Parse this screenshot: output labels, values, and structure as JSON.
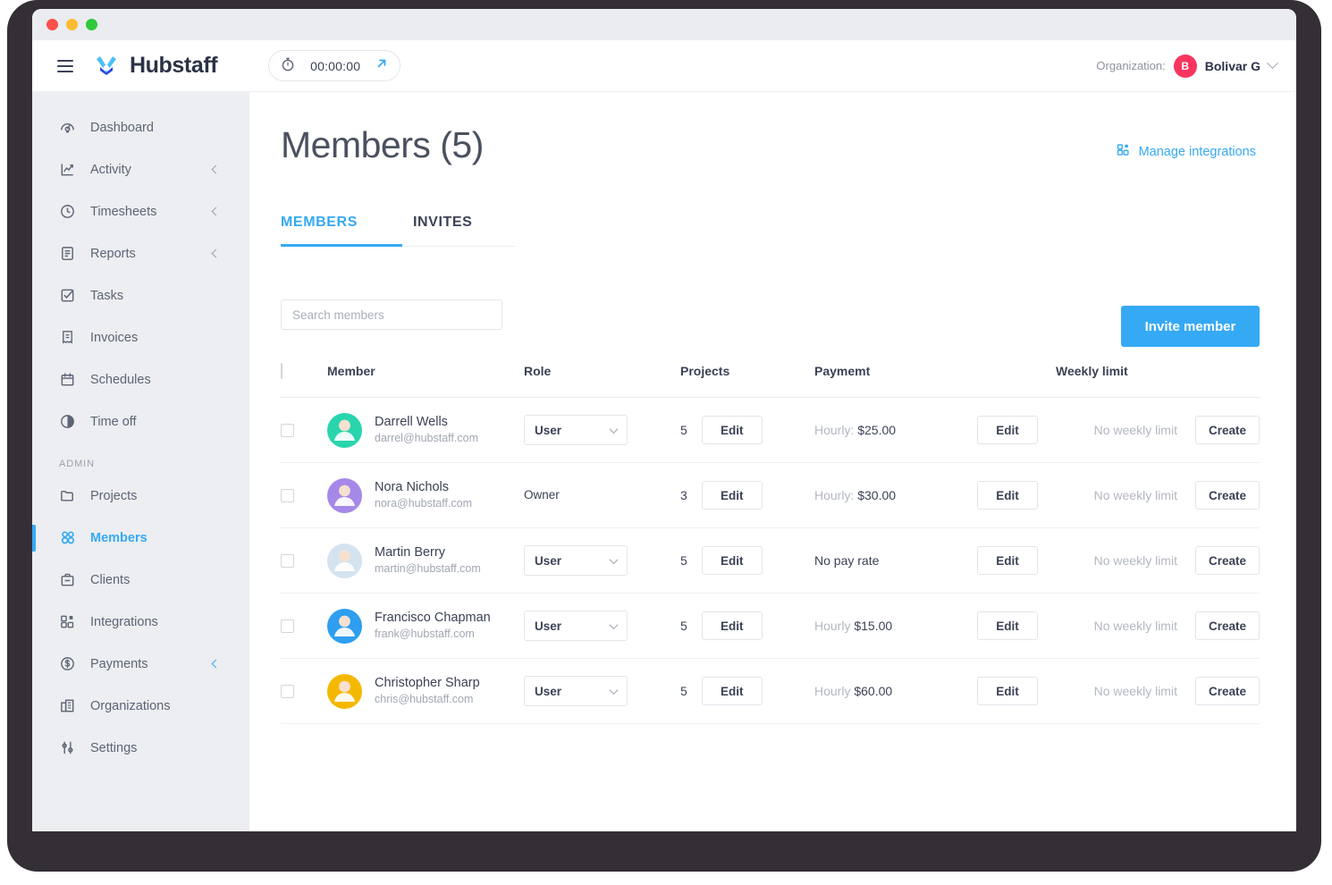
{
  "window": {
    "traffic_lights": [
      "close",
      "minimize",
      "maximize"
    ]
  },
  "header": {
    "menu_icon": "hamburger-icon",
    "brand_name": "Hubstaff",
    "brand_logo_icon": "hubstaff-logo-icon",
    "timer": {
      "icon": "stopwatch-icon",
      "value": "00:00:00",
      "expand_icon": "arrow-up-right-icon"
    },
    "organization": {
      "label": "Organization:",
      "avatar_initial": "B",
      "avatar_color": "#f9355f",
      "name": "Bolivar G",
      "chevron_icon": "chevron-down-icon"
    }
  },
  "sidebar": {
    "items": [
      {
        "label": "Dashboard",
        "icon": "dashboard-icon",
        "has_chevron": false,
        "active": false
      },
      {
        "label": "Activity",
        "icon": "activity-icon",
        "has_chevron": true,
        "active": false
      },
      {
        "label": "Timesheets",
        "icon": "clock-icon",
        "has_chevron": true,
        "active": false
      },
      {
        "label": "Reports",
        "icon": "reports-icon",
        "has_chevron": true,
        "active": false
      },
      {
        "label": "Tasks",
        "icon": "tasks-icon",
        "has_chevron": false,
        "active": false
      },
      {
        "label": "Invoices",
        "icon": "invoice-icon",
        "has_chevron": false,
        "active": false
      },
      {
        "label": "Schedules",
        "icon": "calendar-icon",
        "has_chevron": false,
        "active": false
      },
      {
        "label": "Time off",
        "icon": "timeoff-icon",
        "has_chevron": false,
        "active": false
      }
    ],
    "section_label": "ADMIN",
    "admin_items": [
      {
        "label": "Projects",
        "icon": "folder-icon",
        "has_chevron": false,
        "active": false
      },
      {
        "label": "Members",
        "icon": "members-icon",
        "has_chevron": false,
        "active": true
      },
      {
        "label": "Clients",
        "icon": "briefcase-icon",
        "has_chevron": false,
        "active": false
      },
      {
        "label": "Integrations",
        "icon": "integrations-icon",
        "has_chevron": false,
        "active": false
      },
      {
        "label": "Payments",
        "icon": "dollar-circle-icon",
        "has_chevron": true,
        "active": false
      },
      {
        "label": "Organizations",
        "icon": "building-icon",
        "has_chevron": false,
        "active": false
      },
      {
        "label": "Settings",
        "icon": "sliders-icon",
        "has_chevron": false,
        "active": false
      }
    ]
  },
  "main": {
    "title": "Members (5)",
    "manage_integrations": {
      "icon": "integrations-icon",
      "label": "Manage integrations"
    },
    "tabs": [
      {
        "label": "MEMBERS",
        "active": true
      },
      {
        "label": "INVITES",
        "active": false
      }
    ],
    "invite_button": "Invite member",
    "search": {
      "placeholder": "Search members",
      "value": ""
    },
    "table": {
      "columns": [
        "",
        "Member",
        "Role",
        "Projects",
        "Paymemt",
        "Weekly limit"
      ],
      "select_all_checked": false,
      "rows": [
        {
          "checked": false,
          "avatar_color": "#2ad5ae",
          "name": "Darrell Wells",
          "email": "darrel@hubstaff.com",
          "role": "User",
          "role_editable": true,
          "projects": "5",
          "projects_button": "Edit",
          "payment_prefix": "Hourly: ",
          "payment_amount": "$25.00",
          "payment_no_rate": false,
          "payment_button": "Edit",
          "weekly_limit": "No weekly limit",
          "weekly_button": "Create"
        },
        {
          "checked": false,
          "avatar_color": "#a588e8",
          "name": "Nora Nichols",
          "email": "nora@hubstaff.com",
          "role": "Owner",
          "role_editable": false,
          "projects": "3",
          "projects_button": "Edit",
          "payment_prefix": "Hourly: ",
          "payment_amount": "$30.00",
          "payment_no_rate": false,
          "payment_button": "Edit",
          "weekly_limit": "No weekly limit",
          "weekly_button": "Create"
        },
        {
          "checked": false,
          "avatar_color": "#d5e3f0",
          "name": "Martin Berry",
          "email": "martin@hubstaff.com",
          "role": "User",
          "role_editable": true,
          "projects": "5",
          "projects_button": "Edit",
          "payment_prefix": "",
          "payment_amount": "No pay rate",
          "payment_no_rate": true,
          "payment_button": "Edit",
          "weekly_limit": "No weekly limit",
          "weekly_button": "Create"
        },
        {
          "checked": false,
          "avatar_color": "#2e9ef0",
          "name": "Francisco Chapman",
          "email": "frank@hubstaff.com",
          "role": "User",
          "role_editable": true,
          "projects": "5",
          "projects_button": "Edit",
          "payment_prefix": "Hourly ",
          "payment_amount": "$15.00",
          "payment_no_rate": false,
          "payment_button": "Edit",
          "weekly_limit": "No weekly limit",
          "weekly_button": "Create"
        },
        {
          "checked": false,
          "avatar_color": "#f5b800",
          "name": "Christopher Sharp",
          "email": "chris@hubstaff.com",
          "role": "User",
          "role_editable": true,
          "projects": "5",
          "projects_button": "Edit",
          "payment_prefix": "Hourly ",
          "payment_amount": "$60.00",
          "payment_no_rate": false,
          "payment_button": "Edit",
          "weekly_limit": "No weekly limit",
          "weekly_button": "Create"
        }
      ]
    }
  },
  "colors": {
    "accent": "#36a9f4",
    "sidebar_bg": "#eceef1",
    "text_dark": "#3b4256",
    "text_muted": "#a1a7b3"
  }
}
